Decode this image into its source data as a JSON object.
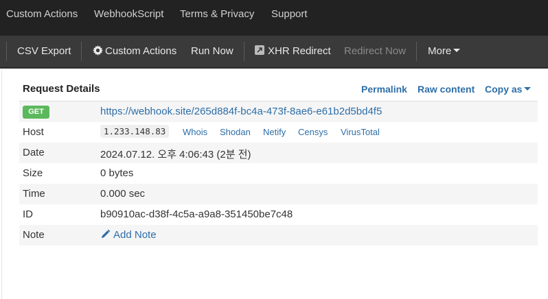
{
  "topnav": {
    "items": [
      "Custom Actions",
      "WebhookScript",
      "Terms & Privacy",
      "Support"
    ]
  },
  "toolbar": {
    "csv_export": "CSV Export",
    "custom_actions": "Custom Actions",
    "run_now": "Run Now",
    "xhr_redirect": "XHR Redirect",
    "redirect_now": "Redirect Now",
    "more": "More"
  },
  "panel": {
    "title": "Request Details",
    "permalink": "Permalink",
    "raw_content": "Raw content",
    "copy_as": "Copy as"
  },
  "request": {
    "method": "GET",
    "url": "https://webhook.site/265d884f-bc4a-473f-8ae6-e61b2d5bd4f5",
    "host_label": "Host",
    "host_ip": "1.233.148.83",
    "host_links": [
      "Whois",
      "Shodan",
      "Netify",
      "Censys",
      "VirusTotal"
    ],
    "date_label": "Date",
    "date_value": "2024.07.12. 오후 4:06:43 (2분 전)",
    "size_label": "Size",
    "size_value": "0 bytes",
    "time_label": "Time",
    "time_value": "0.000 sec",
    "id_label": "ID",
    "id_value": "b90910ac-d38f-4c5a-a9a8-351450be7c48",
    "note_label": "Note",
    "add_note": "Add Note"
  },
  "colors": {
    "topnav_bg": "#222222",
    "toolbar_bg": "#3a3a3a",
    "link": "#2d6ea8",
    "get_badge": "#5cb85c",
    "stripe": "#f5f5f5"
  }
}
